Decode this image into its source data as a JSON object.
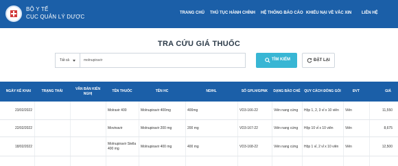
{
  "header": {
    "org_line1": "BỘ Y TẾ",
    "org_line2": "CỤC QUẢN LÝ DƯỢC",
    "nav": [
      "TRANG CHỦ",
      "THỦ TỤC HÀNH CHÍNH",
      "HỆ THỐNG BÁO CÁO",
      "KHIẾU NẠI VỀ VẮC XIN",
      "LIÊN HỆ"
    ]
  },
  "page_title": "TRA CỨU GIÁ THUỐC",
  "search": {
    "filter_value": "Tất cả",
    "query": "molnupiravir",
    "search_label": "TÌM KIẾM",
    "reset_label": "ĐẶT LẠI"
  },
  "table": {
    "columns": [
      "NGÀY KÊ KHAI",
      "TRẠNG THÁI",
      "VĂN BẢN KIẾN NGHỊ",
      "TÊN THUỐC",
      "TÊN HC",
      "ND/HL",
      "SỐ GPLH/GPNK",
      "DẠNG BÀO CHẾ",
      "QUY CÁCH ĐÓNG GÓI",
      "ĐVT",
      "GIÁ"
    ],
    "rows": [
      [
        "23/02/2022",
        "",
        "",
        "Molravir 400",
        "Molnupiravir 400mg",
        "400mg",
        "VD3-166-22",
        "Viên nang cứng",
        "Hộp 1, 2, 3 vỉ x 10 viên",
        "Viên",
        "11,550"
      ],
      [
        "22/02/2022",
        "",
        "",
        "Movinavir",
        "Molnupiravir 200 mg",
        "200 mg",
        "VD3-167-22",
        "Viên nang cứng",
        "Hộp 10 vỉ x 10 viên",
        "Viên",
        "8,675"
      ],
      [
        "18/02/2022",
        "",
        "",
        "Molnupiravir Stella 400 mg",
        "Molnupiravir 400 mg",
        "400 mg",
        "VD3-168-22",
        "Viên nang cứng",
        "Hộp 1 vỉ, 2 vỉ x 10 viên",
        "Viên",
        "12,500"
      ]
    ]
  },
  "colors": {
    "header_bg": "#1b5fa8",
    "search_button": "#38b6d4"
  },
  "icons": {
    "logo": "ministry-of-health-logo",
    "search": "search-icon",
    "reset": "reset-icon",
    "dropdown": "chevron-down-icon"
  }
}
